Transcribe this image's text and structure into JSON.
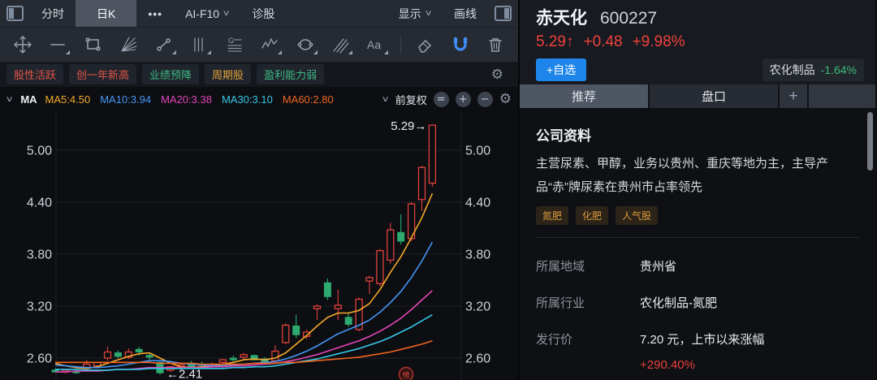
{
  "toolbar": {
    "minute_tab": "分时",
    "daily_tab": "日K",
    "more": "•••",
    "ai_item": "AI-F10",
    "diagnose_item": "诊股",
    "display_item": "显示",
    "drawline_item": "画线"
  },
  "stock_tags": [
    {
      "label": "股性活跃",
      "color": "#e25549"
    },
    {
      "label": "创一年新高",
      "color": "#e25549"
    },
    {
      "label": "业绩预降",
      "color": "#3db983"
    },
    {
      "label": "周期股",
      "color": "#e2a43c"
    },
    {
      "label": "盈利能力弱",
      "color": "#3db983"
    }
  ],
  "legend": {
    "ma_label": "MA",
    "items": [
      {
        "label": "MA5:4.50",
        "color": "#f7a828"
      },
      {
        "label": "MA10:3.94",
        "color": "#4596f7"
      },
      {
        "label": "MA20:3.38",
        "color": "#e445b8"
      },
      {
        "label": "MA30:3.10",
        "color": "#35c8e8"
      },
      {
        "label": "MA60:2.80",
        "color": "#f2641e"
      }
    ],
    "adjust_label": "前复权",
    "zoom_buttons": [
      "=",
      "+",
      "−"
    ]
  },
  "stock": {
    "name": "赤天化",
    "code": "600227",
    "price": "5.29↑",
    "change": "+0.48",
    "change_pct": "+9.98%",
    "watch_button": "+自选",
    "sector": "农化制品",
    "sector_pct": "-1.64%"
  },
  "panel_tabs": {
    "recommend": "推荐",
    "quote": "盘口",
    "add": "+"
  },
  "company": {
    "title": "公司资料",
    "description": "主营尿素、甲醇，业务以贵州、重庆等地为主，主导产品“赤”牌尿素在贵州市占率领先",
    "concept_tags": [
      "氮肥",
      "化肥",
      "人气股"
    ],
    "rows": [
      {
        "label": "所属地域",
        "value": "贵州省"
      },
      {
        "label": "所属行业",
        "value": "农化制品-氮肥"
      },
      {
        "label": "发行价",
        "value": "7.20 元，上市以来涨幅",
        "extra": "+290.40%"
      }
    ]
  },
  "colors": {
    "up": "#e1413c",
    "down": "#2eaa71",
    "price_red": "#f0413d",
    "sector_green": "#3cbb78",
    "accent_blue": "#1e86ea"
  },
  "chart_data": {
    "type": "candlestick",
    "title": "赤天化 600227 日K 前复权",
    "y_ticks": [
      5.0,
      4.4,
      3.8,
      3.2,
      2.6
    ],
    "ylim": [
      2.35,
      5.45
    ],
    "grid": true,
    "annotations": {
      "high_label": "5.29→",
      "high_value": 5.29,
      "high_index": 36,
      "low_label": "←2.41",
      "low_value": 2.41,
      "low_index": 10,
      "stamp": "榜"
    },
    "candles": [
      [
        2.46,
        2.48,
        2.43,
        2.44
      ],
      [
        2.44,
        2.47,
        2.42,
        2.46
      ],
      [
        2.45,
        2.47,
        2.42,
        2.43
      ],
      [
        2.48,
        2.58,
        2.46,
        2.53
      ],
      [
        2.51,
        2.56,
        2.48,
        2.55
      ],
      [
        2.6,
        2.73,
        2.57,
        2.67
      ],
      [
        2.66,
        2.69,
        2.6,
        2.62
      ],
      [
        2.61,
        2.71,
        2.59,
        2.67
      ],
      [
        2.7,
        2.73,
        2.63,
        2.67
      ],
      [
        2.63,
        2.65,
        2.54,
        2.61
      ],
      [
        2.55,
        2.56,
        2.41,
        2.43
      ],
      [
        2.46,
        2.51,
        2.44,
        2.5
      ],
      [
        2.48,
        2.53,
        2.45,
        2.52
      ],
      [
        2.54,
        2.57,
        2.49,
        2.5
      ],
      [
        2.53,
        2.56,
        2.5,
        2.52
      ],
      [
        2.52,
        2.55,
        2.49,
        2.53
      ],
      [
        2.55,
        2.59,
        2.52,
        2.58
      ],
      [
        2.6,
        2.63,
        2.56,
        2.58
      ],
      [
        2.61,
        2.66,
        2.58,
        2.64
      ],
      [
        2.63,
        2.64,
        2.57,
        2.58
      ],
      [
        2.59,
        2.61,
        2.52,
        2.54
      ],
      [
        2.57,
        2.75,
        2.55,
        2.68
      ],
      [
        2.78,
        3.0,
        2.76,
        2.98
      ],
      [
        2.97,
        3.1,
        2.83,
        2.87
      ],
      [
        2.85,
        2.93,
        2.82,
        2.9
      ],
      [
        3.17,
        3.22,
        3.04,
        3.2
      ],
      [
        3.47,
        3.52,
        3.27,
        3.31
      ],
      [
        3.17,
        3.39,
        3.04,
        3.21
      ],
      [
        3.07,
        3.12,
        2.96,
        2.99
      ],
      [
        2.93,
        3.3,
        2.91,
        3.28
      ],
      [
        3.49,
        3.55,
        3.34,
        3.53
      ],
      [
        3.46,
        3.86,
        3.43,
        3.84
      ],
      [
        3.73,
        4.16,
        3.69,
        4.08
      ],
      [
        4.05,
        4.26,
        3.91,
        3.95
      ],
      [
        3.98,
        4.4,
        3.95,
        4.38
      ],
      [
        4.43,
        4.82,
        4.3,
        4.8
      ],
      [
        4.62,
        5.29,
        4.58,
        5.29
      ]
    ],
    "ma_series": [
      {
        "name": "MA5",
        "latest": 4.5,
        "color": "#f7a828",
        "values": [
          2.54,
          2.51,
          2.49,
          2.48,
          2.5,
          2.54,
          2.58,
          2.62,
          2.65,
          2.66,
          2.6,
          2.54,
          2.5,
          2.49,
          2.5,
          2.51,
          2.53,
          2.55,
          2.58,
          2.59,
          2.58,
          2.6,
          2.66,
          2.76,
          2.86,
          2.97,
          3.07,
          3.12,
          3.12,
          3.15,
          3.23,
          3.39,
          3.59,
          3.77,
          3.99,
          4.22,
          4.5
        ]
      },
      {
        "name": "MA10",
        "latest": 3.94,
        "color": "#4596f7",
        "values": [
          2.52,
          2.51,
          2.5,
          2.49,
          2.49,
          2.5,
          2.51,
          2.53,
          2.55,
          2.57,
          2.57,
          2.56,
          2.54,
          2.53,
          2.52,
          2.51,
          2.51,
          2.52,
          2.53,
          2.54,
          2.55,
          2.56,
          2.59,
          2.63,
          2.68,
          2.74,
          2.81,
          2.88,
          2.93,
          2.98,
          3.04,
          3.13,
          3.24,
          3.37,
          3.53,
          3.72,
          3.94
        ]
      },
      {
        "name": "MA20",
        "latest": 3.38,
        "color": "#e445b8",
        "values": [
          2.44,
          2.44,
          2.45,
          2.45,
          2.45,
          2.46,
          2.47,
          2.47,
          2.48,
          2.49,
          2.49,
          2.49,
          2.49,
          2.49,
          2.49,
          2.5,
          2.5,
          2.51,
          2.51,
          2.52,
          2.53,
          2.54,
          2.56,
          2.58,
          2.61,
          2.64,
          2.68,
          2.72,
          2.76,
          2.8,
          2.85,
          2.91,
          2.98,
          3.06,
          3.16,
          3.27,
          3.38
        ]
      },
      {
        "name": "MA30",
        "latest": 3.1,
        "color": "#35c8e8",
        "values": [
          2.47,
          2.47,
          2.47,
          2.46,
          2.46,
          2.46,
          2.47,
          2.47,
          2.47,
          2.48,
          2.48,
          2.48,
          2.48,
          2.48,
          2.48,
          2.48,
          2.48,
          2.49,
          2.49,
          2.5,
          2.5,
          2.51,
          2.53,
          2.55,
          2.57,
          2.59,
          2.62,
          2.65,
          2.68,
          2.71,
          2.75,
          2.79,
          2.84,
          2.9,
          2.96,
          3.03,
          3.1
        ]
      },
      {
        "name": "MA60",
        "latest": 2.8,
        "color": "#f2641e",
        "values": [
          2.55,
          2.55,
          2.55,
          2.55,
          2.55,
          2.55,
          2.55,
          2.55,
          2.55,
          2.55,
          2.54,
          2.54,
          2.54,
          2.54,
          2.53,
          2.53,
          2.53,
          2.53,
          2.53,
          2.54,
          2.54,
          2.54,
          2.55,
          2.55,
          2.56,
          2.57,
          2.58,
          2.59,
          2.6,
          2.61,
          2.63,
          2.65,
          2.67,
          2.7,
          2.73,
          2.76,
          2.8
        ]
      }
    ]
  }
}
